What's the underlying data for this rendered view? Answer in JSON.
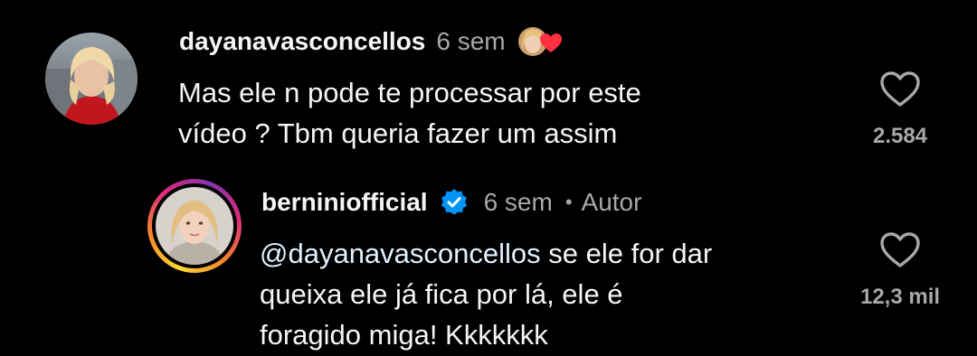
{
  "comments": [
    {
      "username": "dayanavasconcellos",
      "time": "6 sem",
      "reaction_icon": "avatar-heart-reaction-icon",
      "text_lines": [
        "Mas ele n pode te processar por este",
        "vídeo ? Tbm queria fazer um assim"
      ],
      "like_count": "2.584",
      "like_icon": "heart-outline-icon"
    }
  ],
  "reply": {
    "username": "berniniofficial_display",
    "username_text": "berniniofficial",
    "verified": true,
    "time": "6 sem",
    "separator": "•",
    "author_label": "Autor",
    "mention": "@dayanavasconcellos",
    "text_lines": [
      "se ele for dar",
      "queixa ele já fica por lá, ele é",
      "foragido miga! Kkkkkkk"
    ],
    "like_count": "12,3 mil",
    "like_icon": "heart-outline-icon"
  },
  "colors": {
    "background": "#000000",
    "primary_text": "#f5f5f5",
    "secondary_text": "#a8a8a8",
    "verified_blue": "#0095f6",
    "heart_red": "#ff3040"
  }
}
